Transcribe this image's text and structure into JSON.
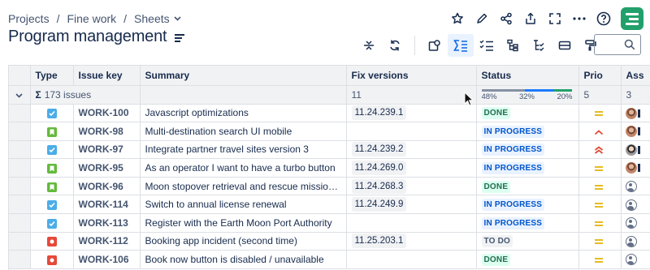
{
  "breadcrumb": {
    "items": [
      "Projects",
      "Fine work",
      "Sheets"
    ],
    "separator": "/"
  },
  "page": {
    "title": "Program management"
  },
  "colors": {
    "brand": "#22a06b",
    "accent": "#0c66e4",
    "done": "#216e4e",
    "in_progress": "#0055cc"
  },
  "top_actions": [
    "star-icon",
    "edit-icon",
    "share-icon",
    "export-icon",
    "fullscreen-icon",
    "more-icon",
    "help-icon"
  ],
  "toolbar": [
    "row-height-icon",
    "refresh-icon",
    "filter-icon",
    "sum-icon",
    "checklist-icon",
    "hierarchy-icon",
    "hierarchy-check-icon",
    "card-icon",
    "paint-icon"
  ],
  "search": {
    "placeholder": ""
  },
  "table": {
    "columns": [
      "Type",
      "Issue key",
      "Summary",
      "Fix versions",
      "Status",
      "Prio",
      "Ass"
    ],
    "summary_row": {
      "sigma": "Σ",
      "issues": "173 issues",
      "fix_versions": "11",
      "status_breakdown": [
        {
          "label": "48%",
          "value": 48,
          "color": "#8590a2"
        },
        {
          "label": "32%",
          "value": 32,
          "color": "#1d7afc"
        },
        {
          "label": "20%",
          "value": 20,
          "color": "#22a06b"
        }
      ],
      "priority": "5",
      "assignee": "3"
    },
    "rows": [
      {
        "type": "task",
        "key": "WORK-100",
        "summary": "Javascript optimizations",
        "fix_version": "11.24.239.1",
        "status": "DONE",
        "status_style": "done",
        "priority": "medium",
        "avatar": "photo1"
      },
      {
        "type": "story",
        "key": "WORK-98",
        "summary": "Multi-destination search UI mobile",
        "fix_version": "",
        "status": "IN PROGRESS",
        "status_style": "prog",
        "priority": "high",
        "avatar": "photo1"
      },
      {
        "type": "task",
        "key": "WORK-97",
        "summary": "Integrate partner travel sites version 3",
        "fix_version": "11.24.239.2",
        "status": "IN PROGRESS",
        "status_style": "prog",
        "priority": "highest",
        "avatar": "photo2"
      },
      {
        "type": "story",
        "key": "WORK-95",
        "summary": "As an operator I want to have a turbo button",
        "fix_version": "11.24.269.0",
        "status": "IN PROGRESS",
        "status_style": "prog",
        "priority": "medium",
        "avatar": "photo1"
      },
      {
        "type": "story",
        "key": "WORK-96",
        "summary": "Moon stopover retrieval and rescue mission tes...",
        "fix_version": "11.24.268.3",
        "status": "DONE",
        "status_style": "done",
        "priority": "medium",
        "avatar": "default"
      },
      {
        "type": "task",
        "key": "WORK-114",
        "summary": "Switch to annual license renewal",
        "fix_version": "11.24.249.9",
        "status": "IN PROGRESS",
        "status_style": "prog",
        "priority": "medium",
        "avatar": "default"
      },
      {
        "type": "task",
        "key": "WORK-113",
        "summary": "Register with the Earth Moon Port Authority",
        "fix_version": "",
        "status": "IN PROGRESS",
        "status_style": "prog",
        "priority": "medium",
        "avatar": "default"
      },
      {
        "type": "bug",
        "key": "WORK-112",
        "summary": "Booking app incident (second time)",
        "fix_version": "11.25.203.1",
        "status": "TO DO",
        "status_style": "todo",
        "priority": "medium",
        "avatar": "default"
      },
      {
        "type": "bug",
        "key": "WORK-106",
        "summary": "Book now button is disabled / unavailable",
        "fix_version": "",
        "status": "DONE",
        "status_style": "done",
        "priority": "medium",
        "avatar": "default"
      }
    ]
  }
}
